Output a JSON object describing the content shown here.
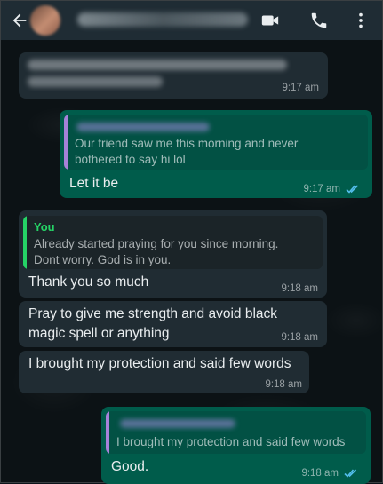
{
  "header": {
    "contact_name": "",
    "icons": [
      "back-arrow-icon",
      "video-call-icon",
      "voice-call-icon",
      "more-options-icon"
    ]
  },
  "colors": {
    "header_bg": "#1f2c34",
    "incoming_bubble": "#202c33",
    "outgoing_bubble": "#005c4b",
    "read_ticks": "#53bdeb",
    "you_label": "#25d366"
  },
  "messages": [
    {
      "direction": "incoming",
      "text": "",
      "time": "9:17 am"
    },
    {
      "direction": "outgoing",
      "quote": {
        "sender": "",
        "text": "Our friend saw me this morning and never bothered to say hi lol"
      },
      "text": "Let it be",
      "time": "9:17 am",
      "status": "read"
    },
    {
      "direction": "incoming",
      "quote": {
        "sender": "You",
        "text": "Already started praying for you since morning. Dont worry. God is in you."
      },
      "text": "Thank you so much",
      "time": "9:18 am"
    },
    {
      "direction": "incoming",
      "text": "Pray to give me strength and avoid black magic spell or anything",
      "time": "9:18 am"
    },
    {
      "direction": "incoming",
      "text": "I brought my protection and said few words",
      "time": "9:18 am"
    },
    {
      "direction": "outgoing",
      "quote": {
        "sender": "",
        "text": "I brought my protection and said few words"
      },
      "text": "Good.",
      "time": "9:18 am",
      "status": "read"
    }
  ]
}
